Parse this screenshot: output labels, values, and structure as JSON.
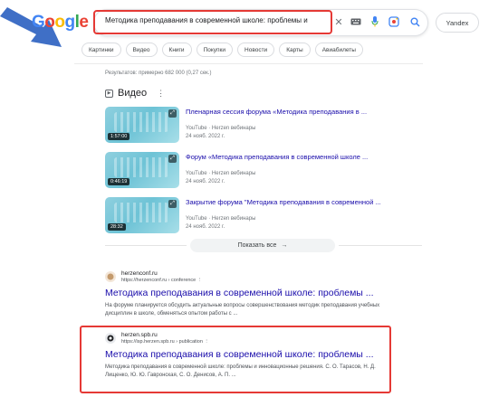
{
  "logo": {
    "letters": [
      {
        "ch": "G",
        "color": "#4285f4"
      },
      {
        "ch": "o",
        "color": "#ea4335"
      },
      {
        "ch": "o",
        "color": "#fbbc05"
      },
      {
        "ch": "g",
        "color": "#4285f4"
      },
      {
        "ch": "l",
        "color": "#34a853"
      },
      {
        "ch": "e",
        "color": "#ea4335"
      }
    ]
  },
  "search": {
    "query": "Методика преподавания в современной школе: проблемы и",
    "clear_icon": "close-icon",
    "keyboard_icon": "keyboard-icon",
    "mic_icon": "mic-icon",
    "lens_icon": "lens-icon",
    "search_icon": "search-icon"
  },
  "header": {
    "yandex_label": "Yandex"
  },
  "chips": [
    "Картинки",
    "Видео",
    "Книги",
    "Покупки",
    "Новости",
    "Карты",
    "Авиабилеты"
  ],
  "stats": "Результатов: примерно 682 000 (0,27 сек.)",
  "videos_section": {
    "title": "Видео",
    "items": [
      {
        "title": "Пленарная сессия форума «Методика преподавания в ...",
        "source": "YouTube · Herzen вебинары",
        "date": "24 нояб. 2022 г.",
        "duration": "1:57:00"
      },
      {
        "title": "Форум «Методика преподавания в современной школе ...",
        "source": "YouTube · Herzen вебинары",
        "date": "24 нояб. 2022 г.",
        "duration": "0:46:19"
      },
      {
        "title": "Закрытие форума \"Методика преподавания в современной ...",
        "source": "YouTube · Herzen вебинары",
        "date": "24 нояб. 2022 г.",
        "duration": "28:32"
      }
    ],
    "show_all": "Показать все"
  },
  "results": [
    {
      "site": "herzenconf.ru",
      "url": "https://herzenconf.ru › conference",
      "title": "Методика преподавания в современной школе: проблемы ...",
      "snippet": "На форуме планируется обсудить актуальные вопросы совершенствования методик преподавания учебных дисциплин в школе, обменяться опытом работы с ..."
    },
    {
      "site": "herzen.spb.ru",
      "url": "https://isp.herzen.spb.ru › publication",
      "title": "Методика преподавания в современной школе: проблемы ...",
      "snippet": "Методика преподавания в современной школе: проблемы и инновационные решения. С. О. Тарасов, Н. Д. Лищенко, Ю. Ю. Гавронская, С. О. Денисов, А. П. ..."
    }
  ]
}
